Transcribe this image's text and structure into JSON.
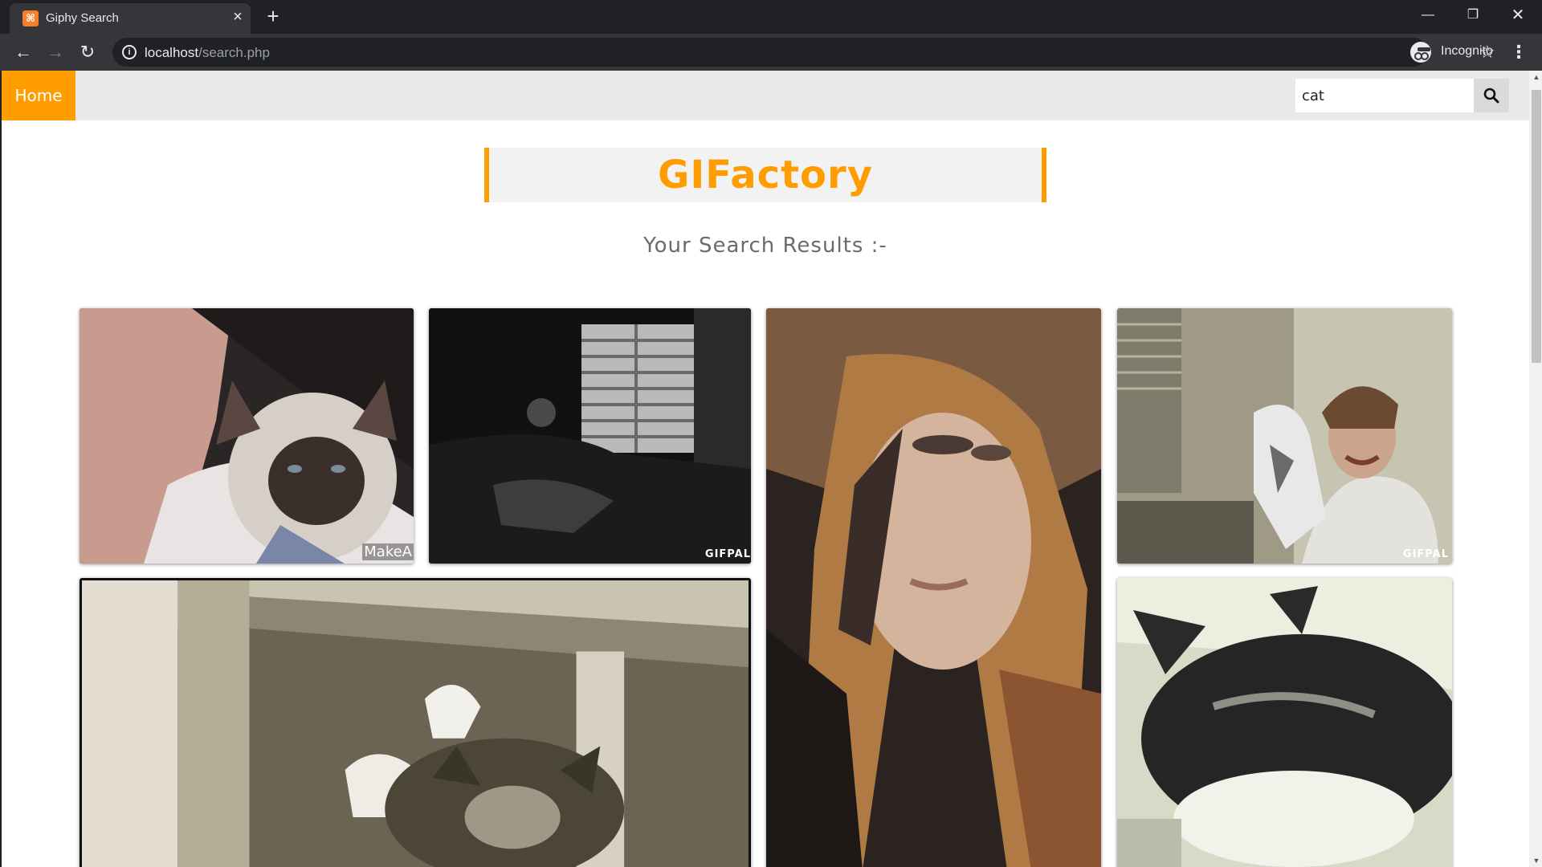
{
  "browser": {
    "tab_title": "Giphy Search",
    "url_host": "localhost",
    "url_path": "/search.php",
    "profile_label": "Incognito"
  },
  "nav": {
    "home_label": "Home",
    "search_value": "cat",
    "accent_color": "#ff9c00"
  },
  "header": {
    "logo": "GIFactory",
    "subtitle": "Your Search Results :-"
  },
  "results": {
    "gif1_watermark": "MakeA",
    "gif2_watermark": "GIFPAL",
    "gif4_watermark": "GIFPAL"
  }
}
